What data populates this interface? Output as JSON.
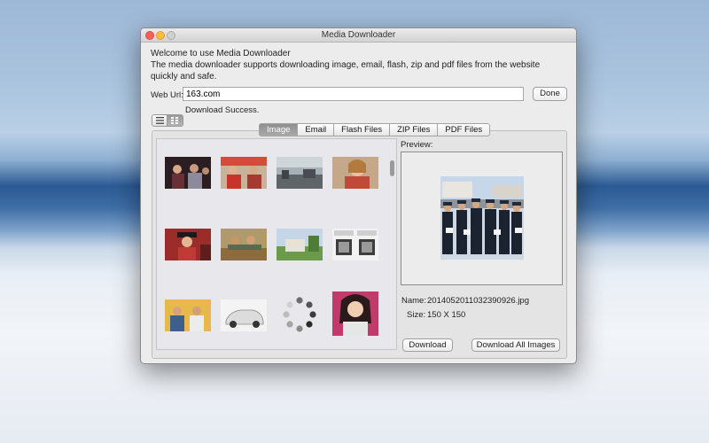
{
  "window": {
    "title": "Media Downloader"
  },
  "welcome": {
    "line1": "Welcome to use Media Downloader",
    "line2": "The media downloader supports downloading image, email, flash, zip and pdf files from the website quickly and safe."
  },
  "url": {
    "label": "Web Url:",
    "value": "163.com",
    "done_label": "Done"
  },
  "status": "Download Success.",
  "view_toggle": {
    "list_icon": "list-icon",
    "grid_icon": "grid-icon",
    "active": "grid"
  },
  "tabs": [
    {
      "label": "Image",
      "active": true
    },
    {
      "label": "Email",
      "active": false
    },
    {
      "label": "Flash Files",
      "active": false
    },
    {
      "label": "ZIP Files",
      "active": false
    },
    {
      "label": "PDF Files",
      "active": false
    }
  ],
  "gallery": {
    "thumbnails": [
      {
        "kind": "photo-people-dark"
      },
      {
        "kind": "photo-people-red"
      },
      {
        "kind": "photo-street"
      },
      {
        "kind": "photo-portrait-woman"
      },
      {
        "kind": "photo-graduation"
      },
      {
        "kind": "photo-classroom"
      },
      {
        "kind": "photo-building-green"
      },
      {
        "kind": "photo-qr-codes"
      },
      {
        "kind": "photo-group-yellow"
      },
      {
        "kind": "photo-car-white"
      },
      {
        "kind": "loading-spinner"
      },
      {
        "kind": "photo-woman-smiling"
      }
    ]
  },
  "preview": {
    "label": "Preview:",
    "name_label": "Name:",
    "name_value": "20140520110323909​26.jpg",
    "size_label": "Size:",
    "size_value": "150 X 150"
  },
  "buttons": {
    "download": "Download",
    "download_all": "Download All Images"
  },
  "colors": {
    "active_tab": "#9c9c9c",
    "close": "#fc605c",
    "minimize": "#fdbc40"
  }
}
